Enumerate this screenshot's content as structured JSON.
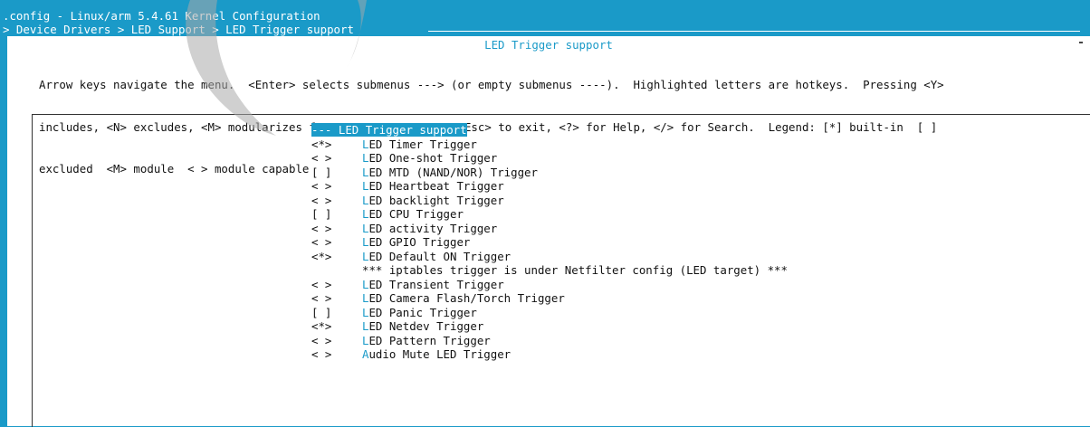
{
  "window": {
    "title": ".config - Linux/arm 5.4.61 Kernel Configuration",
    "breadcrumb": "> Device Drivers > LED Support > LED Trigger support "
  },
  "dialog": {
    "title": "LED Trigger support",
    "help_lines": [
      "Arrow keys navigate the menu.  <Enter> selects submenus ---> (or empty submenus ----).  Highlighted letters are hotkeys.  Pressing <Y>",
      "includes, <N> excludes, <M> modularizes features.  Press <Esc><Esc> to exit, <?> for Help, </> for Search.  Legend: [*] built-in  [ ]",
      "excluded  <M> module  < > module capable"
    ]
  },
  "menu": {
    "items": [
      {
        "sym": "--- ",
        "hotkey": "L",
        "rest": "ED Trigger support",
        "selected": true
      },
      {
        "sym": "<*>",
        "hotkey": "L",
        "rest": "ED Timer Trigger"
      },
      {
        "sym": "< >",
        "hotkey": "L",
        "rest": "ED One-shot Trigger"
      },
      {
        "sym": "[ ]",
        "hotkey": "L",
        "rest": "ED MTD (NAND/NOR) Trigger"
      },
      {
        "sym": "< >",
        "hotkey": "L",
        "rest": "ED Heartbeat Trigger"
      },
      {
        "sym": "< >",
        "hotkey": "L",
        "rest": "ED backlight Trigger"
      },
      {
        "sym": "[ ]",
        "hotkey": "L",
        "rest": "ED CPU Trigger"
      },
      {
        "sym": "< >",
        "hotkey": "L",
        "rest": "ED activity Trigger"
      },
      {
        "sym": "< >",
        "hotkey": "L",
        "rest": "ED GPIO Trigger"
      },
      {
        "sym": "<*>",
        "hotkey": "L",
        "rest": "ED Default ON Trigger"
      },
      {
        "sym": "",
        "hotkey": "",
        "rest": "*** iptables trigger is under Netfilter config (LED target) ***"
      },
      {
        "sym": "< >",
        "hotkey": "L",
        "rest": "ED Transient Trigger"
      },
      {
        "sym": "< >",
        "hotkey": "L",
        "rest": "ED Camera Flash/Torch Trigger"
      },
      {
        "sym": "[ ]",
        "hotkey": "L",
        "rest": "ED Panic Trigger"
      },
      {
        "sym": "<*>",
        "hotkey": "L",
        "rest": "ED Netdev Trigger"
      },
      {
        "sym": "< >",
        "hotkey": "L",
        "rest": "ED Pattern Trigger"
      },
      {
        "sym": "< >",
        "hotkey": "A",
        "rest": "udio Mute LED Trigger"
      }
    ]
  },
  "colors": {
    "background": "#1a9ac8",
    "dialog": "#ffffff",
    "hotkey": "#1a9ac8",
    "text": "#111111"
  }
}
